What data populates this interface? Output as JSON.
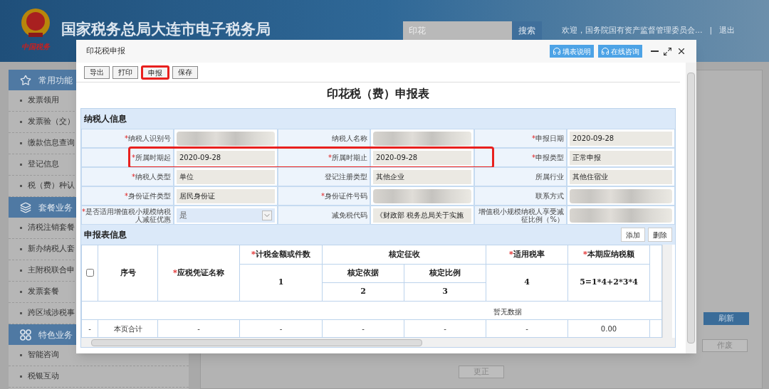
{
  "required_mark": "*",
  "header": {
    "logo_caption": "中国税务",
    "title": "国家税务总局大连市电子税务局",
    "search": {
      "value": "印花"
    },
    "search_button": "搜索",
    "welcome": "欢迎，国务院国有资产监督管理委员会...",
    "separator": "|",
    "logout": "退出"
  },
  "sidebar": {
    "sections": [
      {
        "title": "常用功能",
        "items": [
          "发票领用",
          "发票验（交）",
          "缴款信息查询",
          "登记信息",
          "税（费）种认"
        ]
      },
      {
        "title": "套餐业务",
        "items": [
          "清税注销套餐",
          "新办纳税人套",
          "主附税联合申",
          "发票套餐",
          "跨区域涉税事"
        ]
      },
      {
        "title": "特色业务",
        "items": [
          "智能咨询",
          "税银互动"
        ]
      }
    ]
  },
  "background": {
    "refresh_button": "刷新",
    "void_button": "作废",
    "correct_button": "更正"
  },
  "dialog": {
    "title": "印花税申报",
    "help_buttons": [
      "填表说明",
      "在线咨询"
    ],
    "toolbar": [
      {
        "label": "导出",
        "highlighted": false
      },
      {
        "label": "打印",
        "highlighted": false
      },
      {
        "label": "申报",
        "highlighted": true
      },
      {
        "label": "保存",
        "highlighted": false
      }
    ],
    "form_title": "印花税（费）申报表",
    "taxpayer_section": {
      "title": "纳税人信息",
      "rows": [
        {
          "highlighted": false,
          "cells": [
            {
              "label": "纳税人识别号",
              "required": true,
              "kind": "blurred"
            },
            {
              "label": "纳税人名称",
              "required": false,
              "kind": "blurred"
            },
            {
              "label": "申报日期",
              "required": true,
              "kind": "text",
              "value": "2020-09-28"
            }
          ]
        },
        {
          "highlighted": true,
          "cells": [
            {
              "label": "所属时期起",
              "required": true,
              "kind": "text",
              "value": "2020-09-28"
            },
            {
              "label": "所属时期止",
              "required": true,
              "kind": "text",
              "value": "2020-09-28"
            },
            {
              "label": "申报类型",
              "required": true,
              "kind": "text",
              "value": "正常申报"
            }
          ]
        },
        {
          "highlighted": false,
          "cells": [
            {
              "label": "纳税人类型",
              "required": true,
              "kind": "text",
              "value": "单位"
            },
            {
              "label": "登记注册类型",
              "required": false,
              "kind": "text",
              "value": "其他企业"
            },
            {
              "label": "所属行业",
              "required": false,
              "kind": "text",
              "value": "其他住宿业"
            }
          ]
        },
        {
          "highlighted": false,
          "cells": [
            {
              "label": "身份证件类型",
              "required": true,
              "kind": "text",
              "value": "居民身份证"
            },
            {
              "label": "身份证件号码",
              "required": true,
              "kind": "blurred"
            },
            {
              "label": "联系方式",
              "required": false,
              "kind": "blurred"
            }
          ]
        },
        {
          "highlighted": false,
          "cells": [
            {
              "label": "是否适用增值税小规模纳税人减征优惠",
              "required": true,
              "kind": "select",
              "value": "是"
            },
            {
              "label": "减免税代码",
              "required": false,
              "kind": "text",
              "value": "《财政部 税务总局关于实施"
            },
            {
              "label": "增值税小规模纳税人享受减征比例（%）",
              "required": false,
              "kind": "blurred"
            }
          ]
        }
      ]
    },
    "declaration_section": {
      "title": "申报表信息",
      "buttons": [
        "添加",
        "删除"
      ],
      "header": {
        "select_all_checked": false,
        "seq": "序号",
        "name": {
          "label": "应税凭证名称",
          "required": true
        },
        "amount": {
          "label": "计税金额或件数",
          "required": true,
          "code": "1"
        },
        "assessed": {
          "label": "核定征收",
          "basis": {
            "label": "核定依据",
            "code": "2"
          },
          "ratio": {
            "label": "核定比例",
            "code": "3"
          }
        },
        "rate": {
          "label": "适用税率",
          "required": true,
          "code": "4"
        },
        "tax": {
          "label": "本期应纳税额",
          "required": true,
          "code": "5=1*4+2*3*4"
        }
      },
      "empty_text": "暂无数据",
      "total_row": [
        "-",
        "本页合计",
        "-",
        "-",
        "-",
        "-",
        "-",
        "0.00"
      ]
    }
  }
}
